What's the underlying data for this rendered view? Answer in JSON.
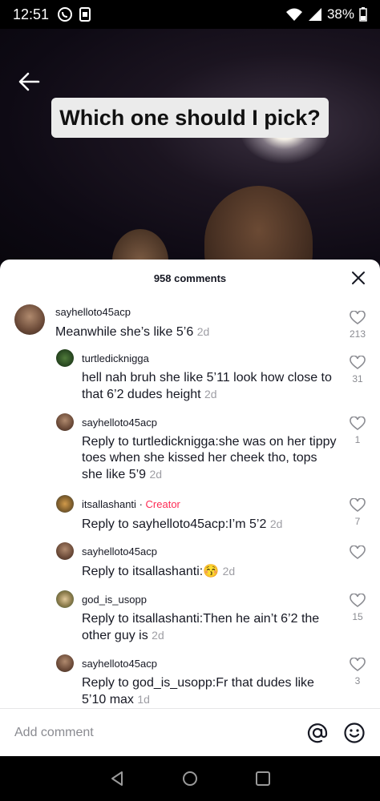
{
  "status": {
    "time": "12:51",
    "battery": "38%",
    "icons": [
      "whatsapp-icon",
      "sim-icon",
      "wifi-icon",
      "signal-icon",
      "battery-icon"
    ]
  },
  "video": {
    "caption": "Which one should I pick?"
  },
  "comments_panel": {
    "count_label": "958 comments",
    "items": [
      {
        "username": "sayhelloto45acp",
        "creator": "",
        "mention": "",
        "text": "Meanwhile she’s like 5’6",
        "time": "2d",
        "likes": "213"
      },
      {
        "username": "turtledicknigga",
        "creator": "",
        "mention": "",
        "text": "hell nah bruh she like 5’11 look how close to that 6’2 dudes height",
        "time": "2d",
        "likes": "31"
      },
      {
        "username": "sayhelloto45acp",
        "creator": "",
        "reply_prefix": "Reply to ",
        "mention": "turtledicknigga",
        "text": ":she was on her tippy toes when she kissed her cheek tho, tops she like 5’9",
        "time": "2d",
        "likes": "1"
      },
      {
        "username": "itsallashanti",
        "creator": "Creator",
        "separator": "·",
        "reply_prefix": "Reply to ",
        "mention": "sayhelloto45acp",
        "text": ":I’m 5’2",
        "time": "2d",
        "likes": "7"
      },
      {
        "username": "sayhelloto45acp",
        "creator": "",
        "reply_prefix": "Reply to ",
        "mention": "itsallashanti",
        "text": ":",
        "emoji": "😚",
        "time": "2d",
        "likes": ""
      },
      {
        "username": "god_is_usopp",
        "creator": "",
        "reply_prefix": "Reply to ",
        "mention": "itsallashanti",
        "text": ":Then he ain’t 6’2 the other guy is",
        "time": "2d",
        "likes": "15"
      },
      {
        "username": "sayhelloto45acp",
        "creator": "",
        "reply_prefix": "Reply to ",
        "mention": "god_is_usopp",
        "text": ":Fr that dudes like 5’10 max",
        "time": "1d",
        "likes": "3"
      }
    ]
  },
  "add_comment": {
    "placeholder": "Add comment"
  },
  "colors": {
    "accent": "#fe2c55",
    "text": "#161823",
    "muted": "#8a8b91"
  }
}
